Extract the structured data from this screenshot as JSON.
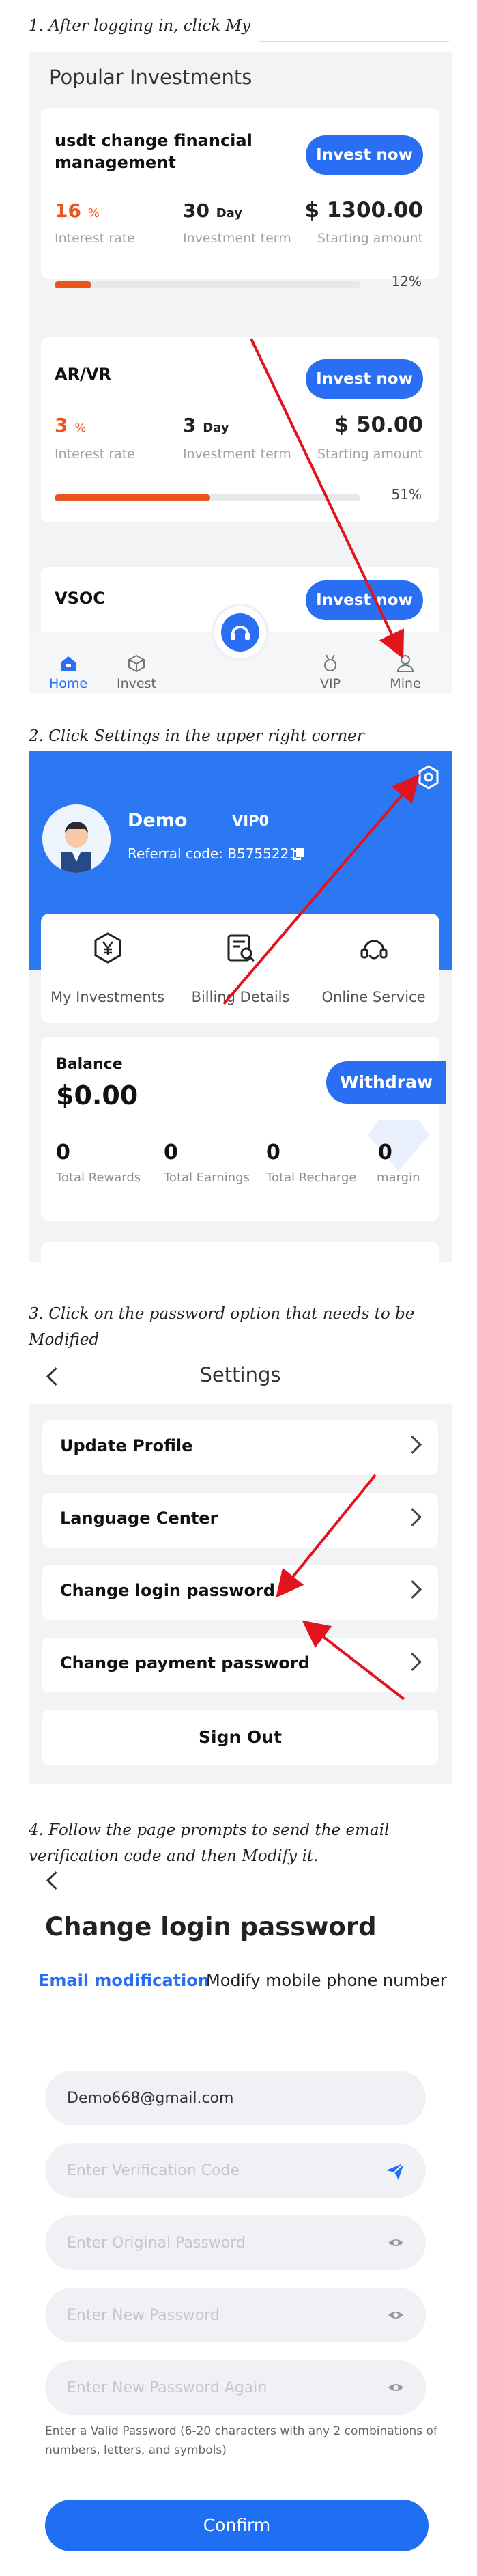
{
  "step1": {
    "caption": "1. After logging in, click My",
    "section_title": "Popular Investments",
    "products": [
      {
        "name": "usdt change financial management",
        "button": "Invest now",
        "rate": "16",
        "rate_unit": "%",
        "term": "30",
        "term_unit": "Day",
        "amount": "$ 1300.00",
        "progress_label": "12%",
        "progress": 0.12
      },
      {
        "name": "AR/VR",
        "button": "Invest now",
        "rate": "3",
        "rate_unit": "%",
        "term": "3",
        "term_unit": "Day",
        "amount": "$ 50.00",
        "progress_label": "51%",
        "progress": 0.51
      },
      {
        "name": "VSOC",
        "button": "Invest now"
      }
    ],
    "labels": {
      "interest_rate": "Interest rate",
      "investment_term": "Investment term",
      "starting_amount": "Starting amount"
    },
    "tabs": [
      "Home",
      "Invest",
      "VIP",
      "Mine"
    ]
  },
  "step2": {
    "caption": "2. Click Settings in the upper right corner",
    "user_name": "Demo",
    "vip": "VIP0",
    "referral_label": "Referral code:",
    "referral_code": "B5755221",
    "quick_links": [
      "My Investments",
      "Billing Details",
      "Online Service"
    ],
    "balance_label": "Balance",
    "balance_value": "$0.00",
    "withdraw": "Withdraw",
    "stats": [
      {
        "value": "0",
        "label": "Total Rewards"
      },
      {
        "value": "0",
        "label": "Total Earnings"
      },
      {
        "value": "0",
        "label": "Total Recharge"
      },
      {
        "value": "0",
        "label": "margin"
      }
    ]
  },
  "step3": {
    "caption_line1": "3. Click on the password option that needs to be",
    "caption_line2": "Modified",
    "title": "Settings",
    "rows": [
      "Update Profile",
      "Language Center",
      "Change login password",
      "Change payment password"
    ],
    "sign_out": "Sign Out"
  },
  "step4": {
    "caption_line1": "4. Follow the page prompts to send the email",
    "caption_line2": "verification code and then Modify it.",
    "title": "Change login password",
    "tab_email": "Email modification",
    "tab_phone": "Modify mobile phone number",
    "email_value": "Demo668@gmail.com",
    "ph_code": "Enter Verification Code",
    "ph_original": "Enter Original Password",
    "ph_new": "Enter New Password",
    "ph_again": "Enter New Password Again",
    "hint": "Enter a Valid Password (6-20 characters with any 2 combinations of numbers, letters, and symbols)",
    "confirm": "Confirm"
  },
  "colors": {
    "accent": "#2a6ff3",
    "orange": "#e8561c",
    "arrow": "#e0151e"
  }
}
